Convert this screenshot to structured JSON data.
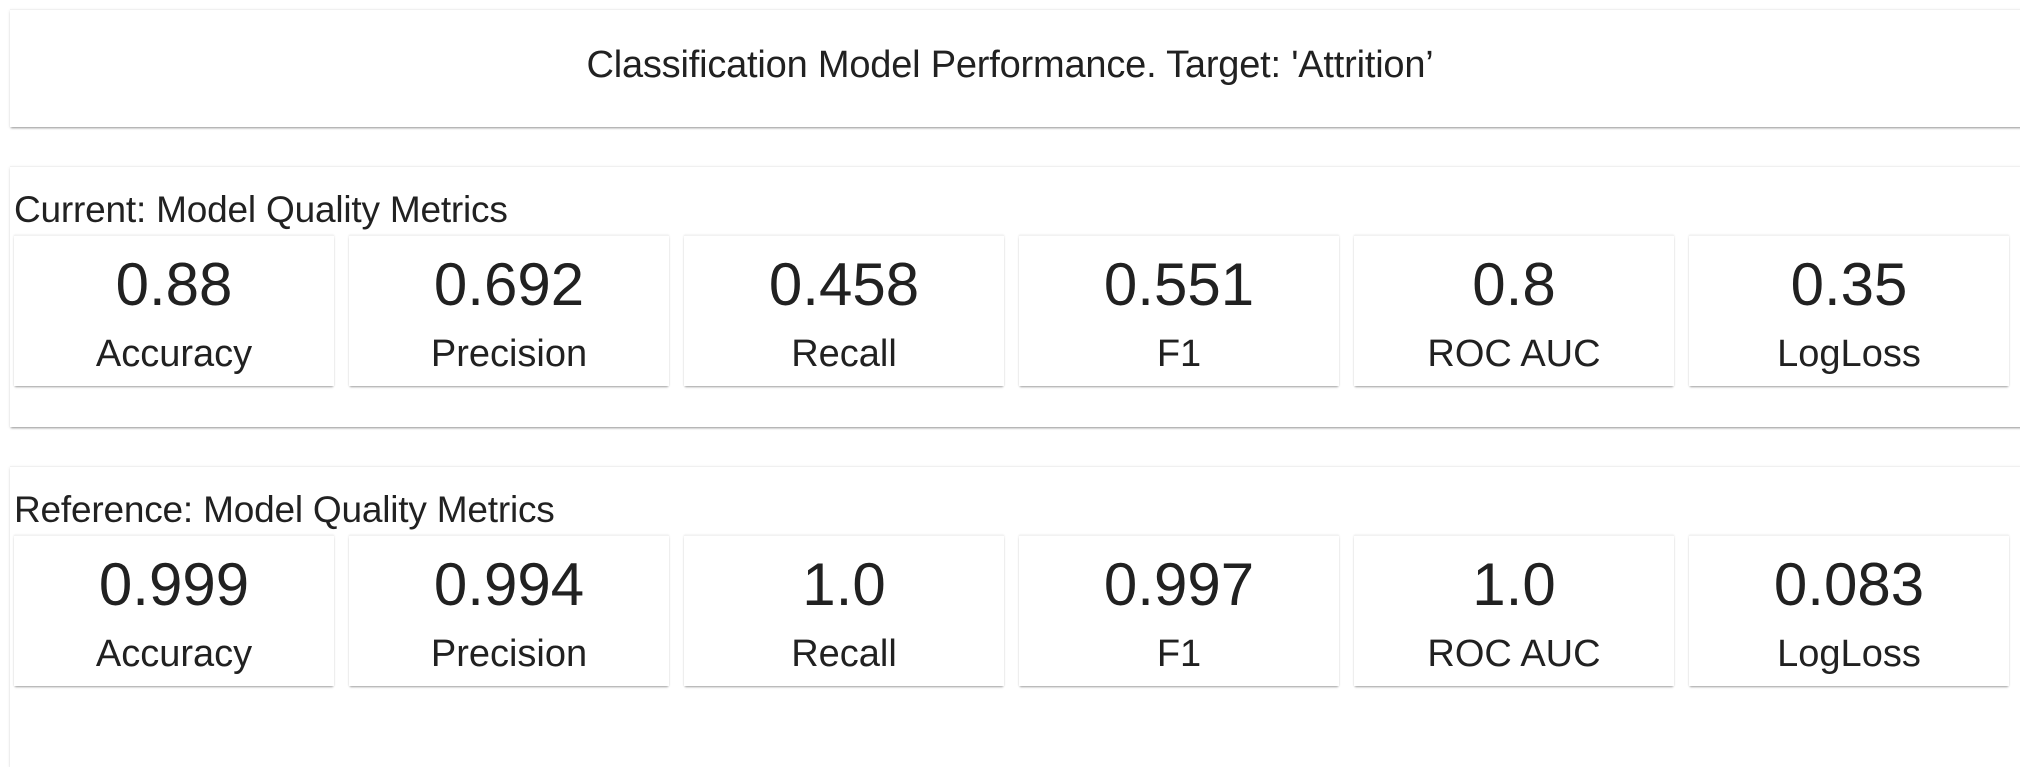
{
  "header": {
    "title": "Classification Model Performance. Target: 'Attrition’"
  },
  "sections": [
    {
      "title": "Current: Model Quality Metrics",
      "metrics": [
        {
          "value": "0.88",
          "label": "Accuracy"
        },
        {
          "value": "0.692",
          "label": "Precision"
        },
        {
          "value": "0.458",
          "label": "Recall"
        },
        {
          "value": "0.551",
          "label": "F1"
        },
        {
          "value": "0.8",
          "label": "ROC AUC"
        },
        {
          "value": "0.35",
          "label": "LogLoss"
        }
      ]
    },
    {
      "title": "Reference: Model Quality Metrics",
      "metrics": [
        {
          "value": "0.999",
          "label": "Accuracy"
        },
        {
          "value": "0.994",
          "label": "Precision"
        },
        {
          "value": "1.0",
          "label": "Recall"
        },
        {
          "value": "0.997",
          "label": "F1"
        },
        {
          "value": "1.0",
          "label": "ROC AUC"
        },
        {
          "value": "0.083",
          "label": "LogLoss"
        }
      ]
    }
  ]
}
